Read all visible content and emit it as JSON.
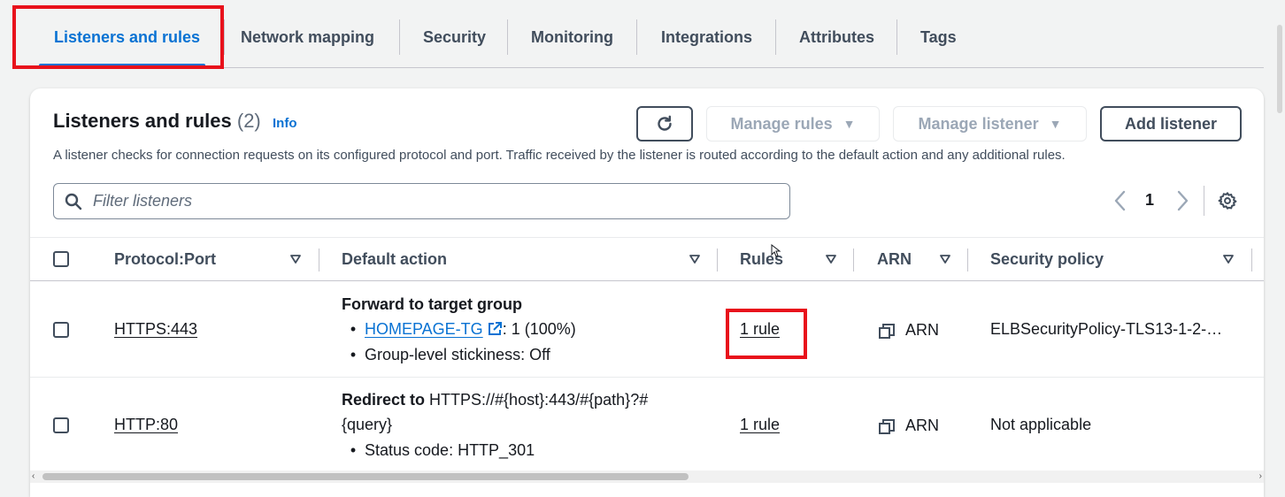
{
  "tabs": [
    {
      "label": "Listeners and rules",
      "active": true
    },
    {
      "label": "Network mapping"
    },
    {
      "label": "Security"
    },
    {
      "label": "Monitoring"
    },
    {
      "label": "Integrations"
    },
    {
      "label": "Attributes"
    },
    {
      "label": "Tags"
    }
  ],
  "panel": {
    "title": "Listeners and rules",
    "count": "(2)",
    "info": "Info",
    "description": "A listener checks for connection requests on its configured protocol and port. Traffic received by the listener is routed according to the default action and any additional rules.",
    "buttons": {
      "refresh_icon": "refresh-icon",
      "manage_rules": "Manage rules",
      "manage_listener": "Manage listener",
      "add_listener": "Add listener"
    },
    "filter": {
      "placeholder": "Filter listeners",
      "value": ""
    },
    "pagination": {
      "current_page": "1"
    }
  },
  "table": {
    "columns": [
      "Protocol:Port",
      "Default action",
      "Rules",
      "ARN",
      "Security policy"
    ],
    "rows": [
      {
        "protocol_port": "HTTPS:443",
        "action_title": "Forward to target group",
        "action_title_rest": "",
        "action_line2": "",
        "target_group": "HOMEPAGE-TG",
        "target_weight": ": 1 (100%)",
        "stickiness": "Group-level stickiness: Off",
        "rules": "1 rule",
        "arn": "ARN",
        "security_policy": "ELBSecurityPolicy-TLS13-1-2-…"
      },
      {
        "protocol_port": "HTTP:80",
        "action_title": "Redirect to",
        "action_title_rest": " HTTPS://#{host}:443/#{path}?#",
        "action_line2": "{query}",
        "status_code": "Status code: HTTP_301",
        "rules": "1 rule",
        "arn": "ARN",
        "security_policy": "Not applicable"
      }
    ]
  },
  "colors": {
    "link": "#0972d3",
    "highlight": "#e8111b",
    "text": "#16191f",
    "muted": "#414d5c",
    "disabled": "#9ba7b6"
  }
}
